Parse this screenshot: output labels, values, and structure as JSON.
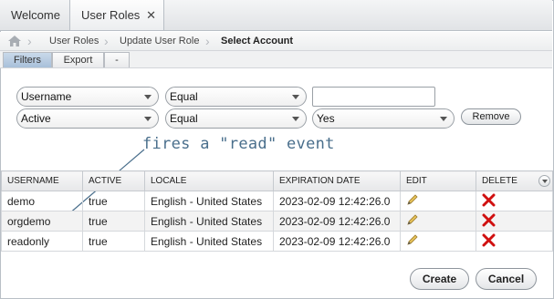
{
  "tabs": [
    {
      "label": "Welcome"
    },
    {
      "label": "User Roles",
      "close": "✕"
    }
  ],
  "breadcrumb": [
    "User Roles",
    "Update User Role",
    "Select Account"
  ],
  "toolbar": {
    "filters": "Filters",
    "export": "Export",
    "minus": "-"
  },
  "filters": {
    "row1": {
      "field": "Username",
      "operator": "Equal",
      "value": ""
    },
    "row2": {
      "field": "Active",
      "operator": "Equal",
      "value": "Yes"
    },
    "remove_label": "Remove"
  },
  "annotation": "fires a \"read\" event",
  "table": {
    "columns": [
      "USERNAME",
      "ACTIVE",
      "LOCALE",
      "EXPIRATION DATE",
      "EDIT",
      "DELETE"
    ],
    "rows": [
      {
        "username": "demo",
        "active": "true",
        "locale": "English - United States",
        "expiration": "2023-02-09 12:42:26.0"
      },
      {
        "username": "orgdemo",
        "active": "true",
        "locale": "English - United States",
        "expiration": "2023-02-09 12:42:26.0"
      },
      {
        "username": "readonly",
        "active": "true",
        "locale": "English - United States",
        "expiration": "2023-02-09 12:42:26.0"
      }
    ]
  },
  "actions": {
    "create": "Create",
    "cancel": "Cancel"
  },
  "icons": {
    "home": "home-icon",
    "edit": "pencil-icon",
    "delete": "red-x-icon",
    "menu": "chevron-down-icon"
  }
}
